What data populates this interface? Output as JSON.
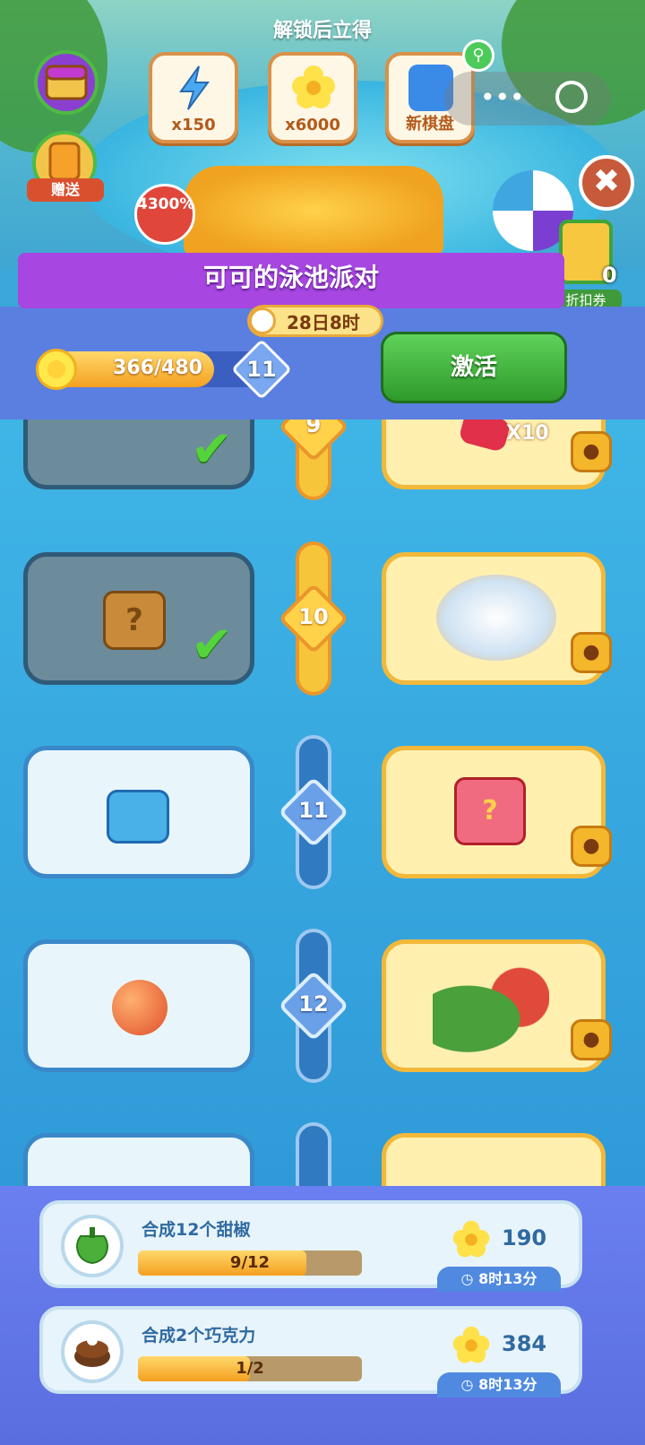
{
  "header": {
    "unlock_title": "解锁后立得",
    "rewards": [
      {
        "icon": "lightning-icon",
        "label": "x150"
      },
      {
        "icon": "flower-icon",
        "label": "x6000"
      },
      {
        "icon": "board-icon",
        "label": "新棋盘"
      }
    ],
    "gift_label": "赠送",
    "discount_badge": "4300%",
    "coupon_count": "0",
    "coupon_label": "折扣券",
    "close_symbol": "✖"
  },
  "event": {
    "title": "可可的泳池派对",
    "timer": "28日8时",
    "progress_text": "366/480",
    "progress_fraction": 0.7625,
    "level": "11",
    "activate_label": "激活"
  },
  "levels": [
    {
      "level": "9",
      "claimed": true,
      "right_item": "ruby-icon",
      "right_label": "X10"
    },
    {
      "level": "10",
      "claimed": true,
      "left_item": "mystery-box-icon",
      "right_item": "tea-set-icon"
    },
    {
      "level": "11",
      "claimed": false,
      "left_item": "blue-chest-icon",
      "right_item": "red-chest-icon"
    },
    {
      "level": "12",
      "claimed": false,
      "left_item": "peach-icon",
      "right_item": "vegetables-icon"
    }
  ],
  "tasks": [
    {
      "name": "合成12个甜椒",
      "progress": "9/12",
      "fraction": 0.75,
      "reward": "190",
      "time": "8时13分",
      "icon": "pepper-icon"
    },
    {
      "name": "合成2个巧克力",
      "progress": "1/2",
      "fraction": 0.5,
      "reward": "384",
      "time": "8时13分",
      "icon": "chocolate-icon"
    }
  ],
  "colors": {
    "accent_purple": "#a746e0",
    "accent_green": "#2f9a2a",
    "gold": "#f4a020"
  }
}
